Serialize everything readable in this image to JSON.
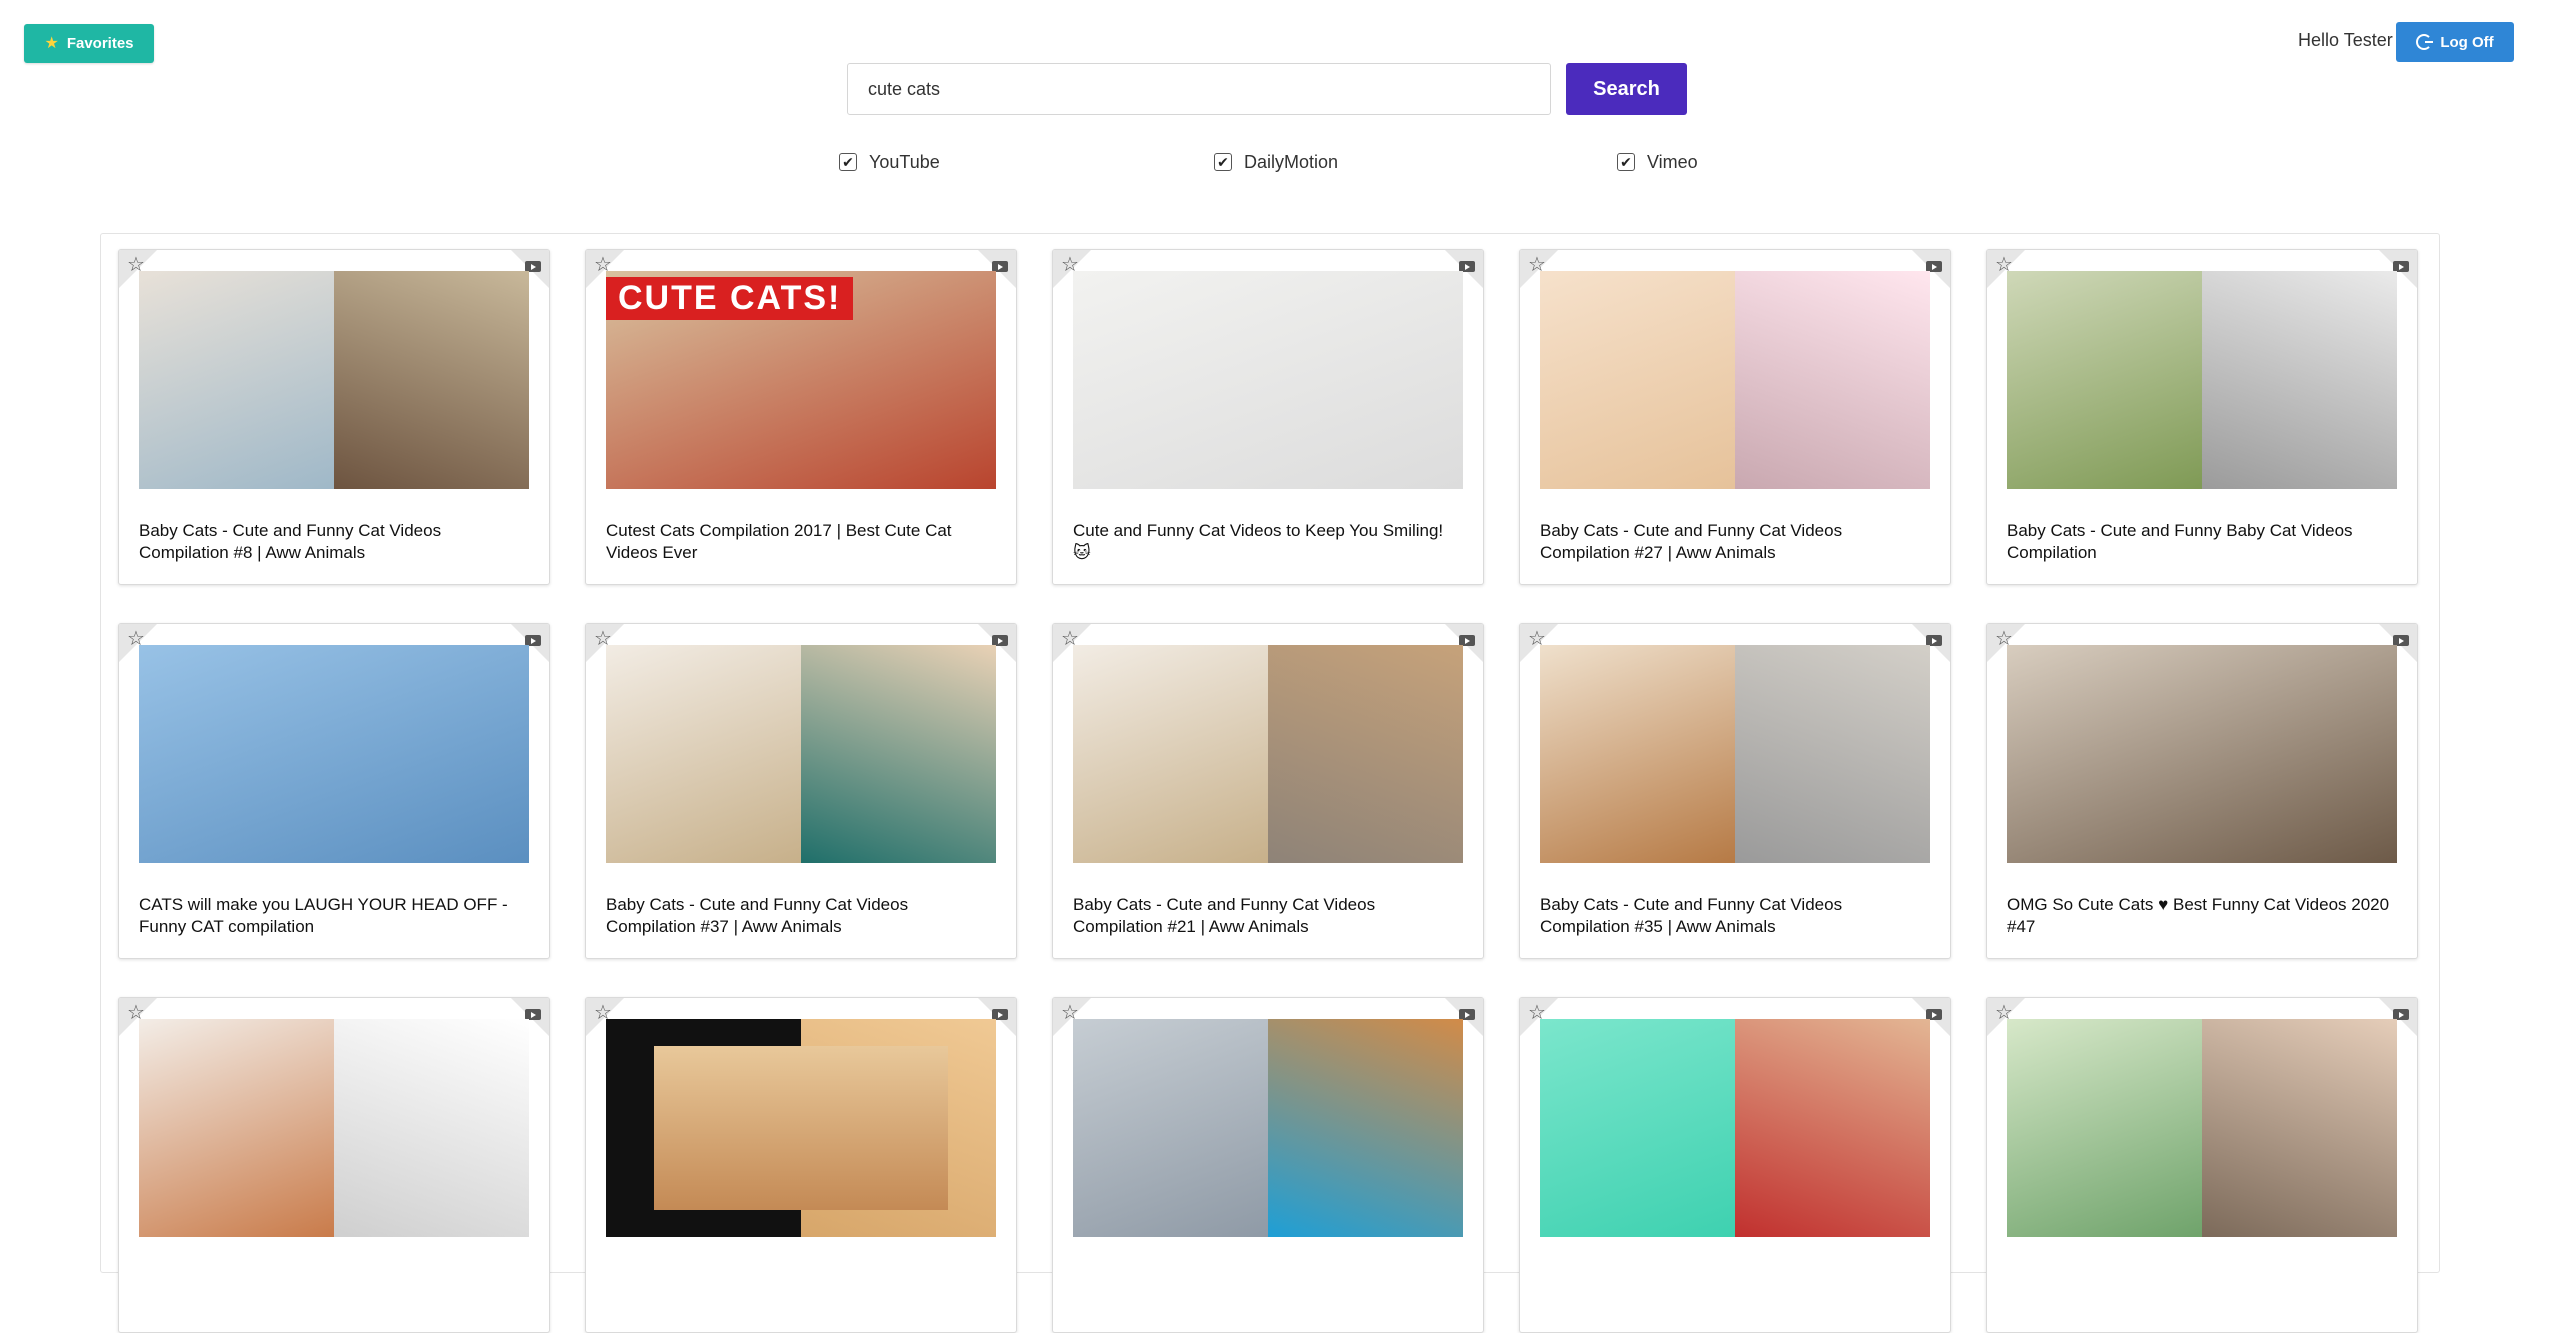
{
  "header": {
    "favorites_label": "Favorites",
    "favorites_icon": "star-icon",
    "greeting": "Hello Tester",
    "logoff_label": "Log Off",
    "logoff_icon": "google-icon"
  },
  "search": {
    "query": "cute cats",
    "button_label": "Search"
  },
  "sources": [
    {
      "label": "YouTube",
      "checked": true
    },
    {
      "label": "DailyMotion",
      "checked": true
    },
    {
      "label": "Vimeo",
      "checked": true
    }
  ],
  "colors": {
    "favorites_bg": "#1fb7a4",
    "logoff_bg": "#2f86d6",
    "search_btn_bg": "#4b2bbd"
  },
  "thumb_banner": "CUTE CATS!",
  "videos": [
    {
      "title": "Baby Cats - Cute and Funny Cat Videos Compilation #8 | Aww Animals"
    },
    {
      "title": "Cutest Cats Compilation 2017 | Best Cute Cat Videos Ever"
    },
    {
      "title": "Cute and Funny Cat Videos to Keep You Smiling! 🐱"
    },
    {
      "title": "Baby Cats - Cute and Funny Cat Videos Compilation #27 | Aww Animals"
    },
    {
      "title": "Baby Cats - Cute and Funny Baby Cat Videos Compilation"
    },
    {
      "title": "CATS will make you LAUGH YOUR HEAD OFF - Funny CAT compilation"
    },
    {
      "title": "Baby Cats - Cute and Funny Cat Videos Compilation #37 | Aww Animals"
    },
    {
      "title": "Baby Cats - Cute and Funny Cat Videos Compilation #21 | Aww Animals"
    },
    {
      "title": "Baby Cats - Cute and Funny Cat Videos Compilation #35 | Aww Animals"
    },
    {
      "title": "OMG So Cute Cats ♥ Best Funny Cat Videos 2020 #47"
    },
    {
      "title": ""
    },
    {
      "title": ""
    },
    {
      "title": ""
    },
    {
      "title": ""
    },
    {
      "title": ""
    }
  ]
}
